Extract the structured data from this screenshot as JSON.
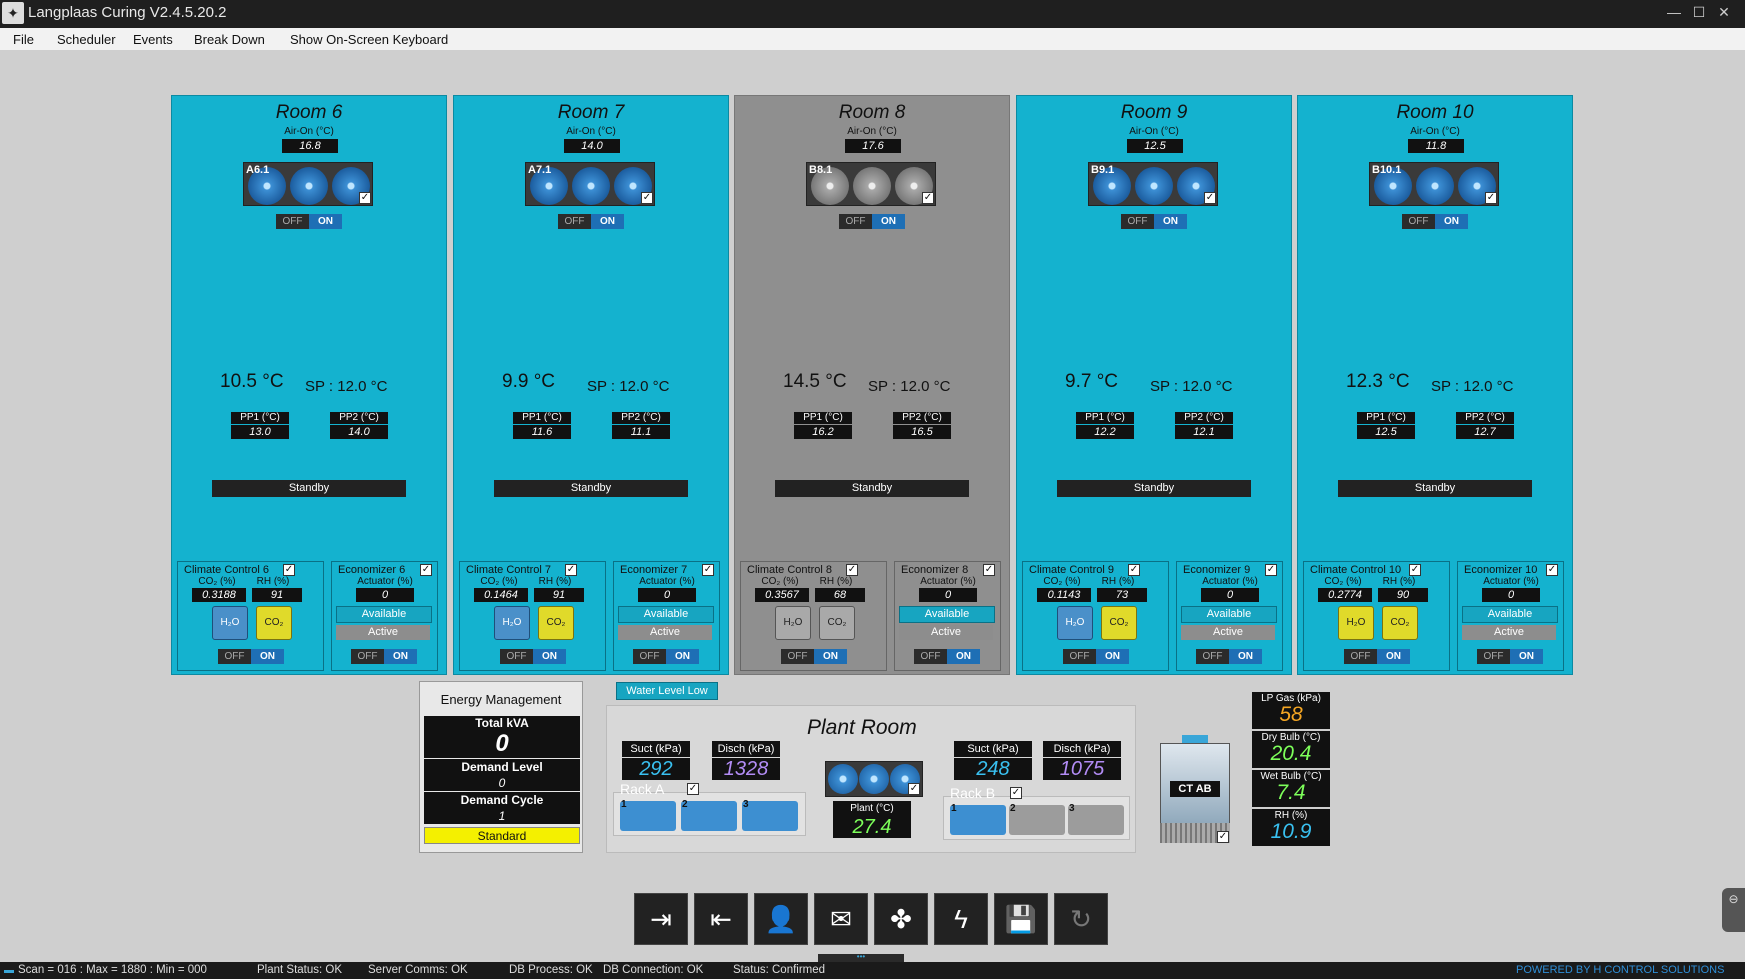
{
  "window": {
    "title": "Langplaas Curing V2.4.5.20.2"
  },
  "menu": [
    "File",
    "Scheduler",
    "Events",
    "Break Down",
    "Show On-Screen Keyboard"
  ],
  "rooms": [
    {
      "name": "Room 6",
      "air_on_label": "Air-On (°C)",
      "air_on": "16.8",
      "fan_id": "A6.1",
      "off": "OFF",
      "on": "ON",
      "temp": "10.5 °C",
      "sp": "SP : 12.0 °C",
      "pp1_label": "PP1 (°C)",
      "pp1": "13.0",
      "pp2_label": "PP2 (°C)",
      "pp2": "14.0",
      "status": "Standby",
      "climate_title": "Climate Control 6",
      "co2_label": "CO₂ (%)",
      "co2": "0.3188",
      "rh_label": "RH (%)",
      "rh": "91",
      "econ_title": "Economizer 6",
      "act_label": "Actuator (%)",
      "act": "0",
      "available": "Available",
      "active": "Active",
      "h2o_label": "H₂O",
      "co2_equip_label": "CO₂",
      "style": "blue",
      "h2o_color": "blue",
      "co2_color": "yellow"
    },
    {
      "name": "Room 7",
      "air_on_label": "Air-On (°C)",
      "air_on": "14.0",
      "fan_id": "A7.1",
      "off": "OFF",
      "on": "ON",
      "temp": "9.9 °C",
      "sp": "SP : 12.0 °C",
      "pp1_label": "PP1 (°C)",
      "pp1": "11.6",
      "pp2_label": "PP2 (°C)",
      "pp2": "11.1",
      "status": "Standby",
      "climate_title": "Climate Control 7",
      "co2_label": "CO₂ (%)",
      "co2": "0.1464",
      "rh_label": "RH (%)",
      "rh": "91",
      "econ_title": "Economizer 7",
      "act_label": "Actuator (%)",
      "act": "0",
      "available": "Available",
      "active": "Active",
      "h2o_label": "H₂O",
      "co2_equip_label": "CO₂",
      "style": "blue",
      "h2o_color": "blue",
      "co2_color": "yellow"
    },
    {
      "name": "Room 8",
      "air_on_label": "Air-On (°C)",
      "air_on": "17.6",
      "fan_id": "B8.1",
      "off": "OFF",
      "on": "ON",
      "temp": "14.5 °C",
      "sp": "SP : 12.0 °C",
      "pp1_label": "PP1 (°C)",
      "pp1": "16.2",
      "pp2_label": "PP2 (°C)",
      "pp2": "16.5",
      "status": "Standby",
      "climate_title": "Climate Control 8",
      "co2_label": "CO₂ (%)",
      "co2": "0.3567",
      "rh_label": "RH (%)",
      "rh": "68",
      "econ_title": "Economizer 8",
      "act_label": "Actuator (%)",
      "act": "0",
      "available": "Available",
      "active": "Active",
      "h2o_label": "H₂O",
      "co2_equip_label": "CO₂",
      "style": "grey",
      "h2o_color": "grey",
      "co2_color": "grey"
    },
    {
      "name": "Room 9",
      "air_on_label": "Air-On (°C)",
      "air_on": "12.5",
      "fan_id": "B9.1",
      "off": "OFF",
      "on": "ON",
      "temp": "9.7 °C",
      "sp": "SP : 12.0 °C",
      "pp1_label": "PP1 (°C)",
      "pp1": "12.2",
      "pp2_label": "PP2 (°C)",
      "pp2": "12.1",
      "status": "Standby",
      "climate_title": "Climate Control 9",
      "co2_label": "CO₂ (%)",
      "co2": "0.1143",
      "rh_label": "RH (%)",
      "rh": "73",
      "econ_title": "Economizer 9",
      "act_label": "Actuator (%)",
      "act": "0",
      "available": "Available",
      "active": "Active",
      "h2o_label": "H₂O",
      "co2_equip_label": "CO₂",
      "style": "blue",
      "h2o_color": "blue",
      "co2_color": "yellow"
    },
    {
      "name": "Room 10",
      "air_on_label": "Air-On (°C)",
      "air_on": "11.8",
      "fan_id": "B10.1",
      "off": "OFF",
      "on": "ON",
      "temp": "12.3 °C",
      "sp": "SP : 12.0 °C",
      "pp1_label": "PP1 (°C)",
      "pp1": "12.5",
      "pp2_label": "PP2 (°C)",
      "pp2": "12.7",
      "status": "Standby",
      "climate_title": "Climate Control 10",
      "co2_label": "CO₂ (%)",
      "co2": "0.2774",
      "rh_label": "RH (%)",
      "rh": "90",
      "econ_title": "Economizer 10",
      "act_label": "Actuator (%)",
      "act": "0",
      "available": "Available",
      "active": "Active",
      "h2o_label": "H₂O",
      "co2_equip_label": "CO₂",
      "style": "blue",
      "h2o_color": "yellow",
      "co2_color": "yellow"
    }
  ],
  "energy": {
    "title": "Energy Management",
    "kva_label": "Total kVA",
    "kva": "0",
    "demand_level_label": "Demand Level",
    "demand_level": "0",
    "demand_cycle_label": "Demand Cycle",
    "demand_cycle": "1",
    "mode": "Standard"
  },
  "water_level": "Water Level Low",
  "plant": {
    "title": "Plant Room",
    "rack_a": {
      "label": "Rack A",
      "suct_label": "Suct (kPa)",
      "suct": "292",
      "disch_label": "Disch (kPa)",
      "disch": "1328",
      "compressors": [
        "1",
        "2",
        "3"
      ]
    },
    "rack_b": {
      "label": "Rack B",
      "suct_label": "Suct (kPa)",
      "suct": "248",
      "disch_label": "Disch (kPa)",
      "disch": "1075",
      "compressors": [
        "1",
        "2",
        "3"
      ]
    },
    "plant_temp_label": "Plant (°C)",
    "plant_temp": "27.4",
    "ct_label": "CT AB"
  },
  "weather": [
    {
      "label": "LP Gas (kPa)",
      "value": "58",
      "color": "#f5a623"
    },
    {
      "label": "Dry Bulb (°C)",
      "value": "20.4",
      "color": "#7dff5a"
    },
    {
      "label": "Wet Bulb (°C)",
      "value": "7.4",
      "color": "#7dff5a"
    },
    {
      "label": "RH (%)",
      "value": "10.9",
      "color": "#39c0f0"
    }
  ],
  "toolbar_icons": [
    "login-icon",
    "logout-icon",
    "user-settings-icon",
    "mail-icon",
    "fan-settings-icon",
    "power-icon",
    "save-icon",
    "refresh-icon"
  ],
  "status": {
    "scan": "Scan = 016 : Max = 1880 : Min = 000",
    "plant": "Plant Status: OK",
    "server": "Server Comms: OK",
    "db_process": "DB Process:  OK",
    "db_conn": "DB Connection:  OK",
    "status": "Status:  Confirmed",
    "brand": "POWERED BY H CONTROL SOLUTIONS"
  }
}
